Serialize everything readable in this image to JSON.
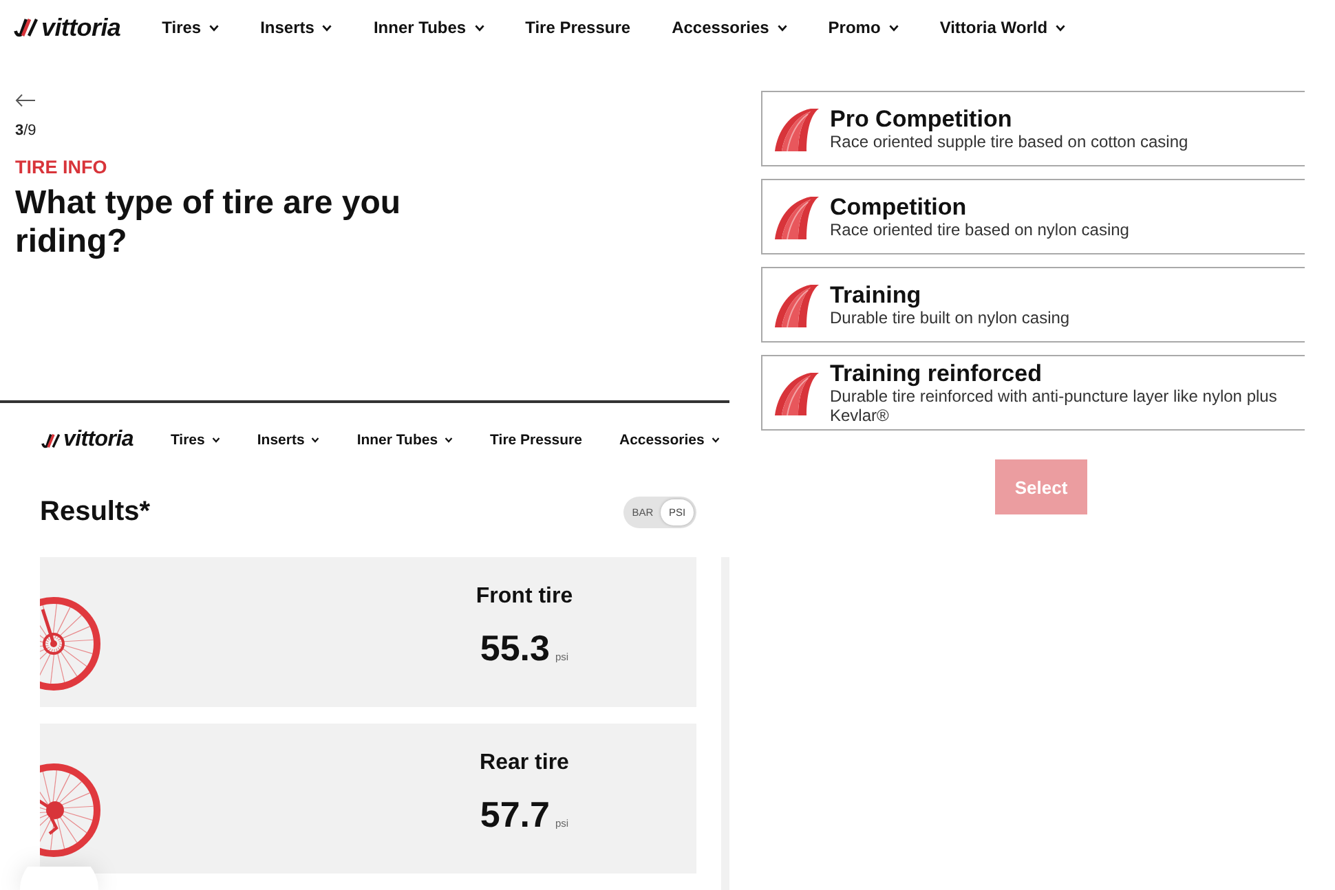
{
  "nav": {
    "logo": "vittoria",
    "items": [
      {
        "label": "Tires",
        "dropdown": true
      },
      {
        "label": "Inserts",
        "dropdown": true
      },
      {
        "label": "Inner Tubes",
        "dropdown": true
      },
      {
        "label": "Tire Pressure",
        "dropdown": false
      },
      {
        "label": "Accessories",
        "dropdown": true
      },
      {
        "label": "Promo",
        "dropdown": true
      },
      {
        "label": "Vittoria World",
        "dropdown": true
      }
    ]
  },
  "quiz": {
    "step": "**3**/9",
    "section": "TIRE INFO",
    "question": "What type of tire are you riding?"
  },
  "tire_types": [
    {
      "name": "Pro Competition",
      "description": "Race oriented supple tire based on cotton casing",
      "selected": false
    },
    {
      "name": "Competition",
      "description": "Race oriented tire based on nylon casing",
      "selected": false
    },
    {
      "name": "Training",
      "description": "Durable tire built on nylon casing",
      "selected": false
    },
    {
      "name": "Training reinforced",
      "description": "Durable tire reinforced with anti-puncture layer like nylon plus Kevlar®",
      "selected": false
    }
  ],
  "select_button": {
    "label": "Select",
    "disabled": true
  },
  "inset": {
    "nav": {
      "logo": "vittoria",
      "items": [
        {
          "label": "Tires",
          "dropdown": true
        },
        {
          "label": "Inserts",
          "dropdown": true
        },
        {
          "label": "Inner Tubes",
          "dropdown": true
        },
        {
          "label": "Tire Pressure",
          "dropdown": false
        },
        {
          "label": "Accessories",
          "dropdown": true
        }
      ]
    },
    "results": {
      "title": "Results*",
      "units": [
        {
          "label": "BAR",
          "selected": false
        },
        {
          "label": "PSI",
          "selected": true
        }
      ],
      "tires": [
        {
          "kind": "front",
          "label": "Front tire",
          "value": "55.3",
          "unit": "psi"
        },
        {
          "kind": "rear",
          "label": "Rear tire",
          "value": "57.7",
          "unit": "psi"
        }
      ]
    }
  }
}
